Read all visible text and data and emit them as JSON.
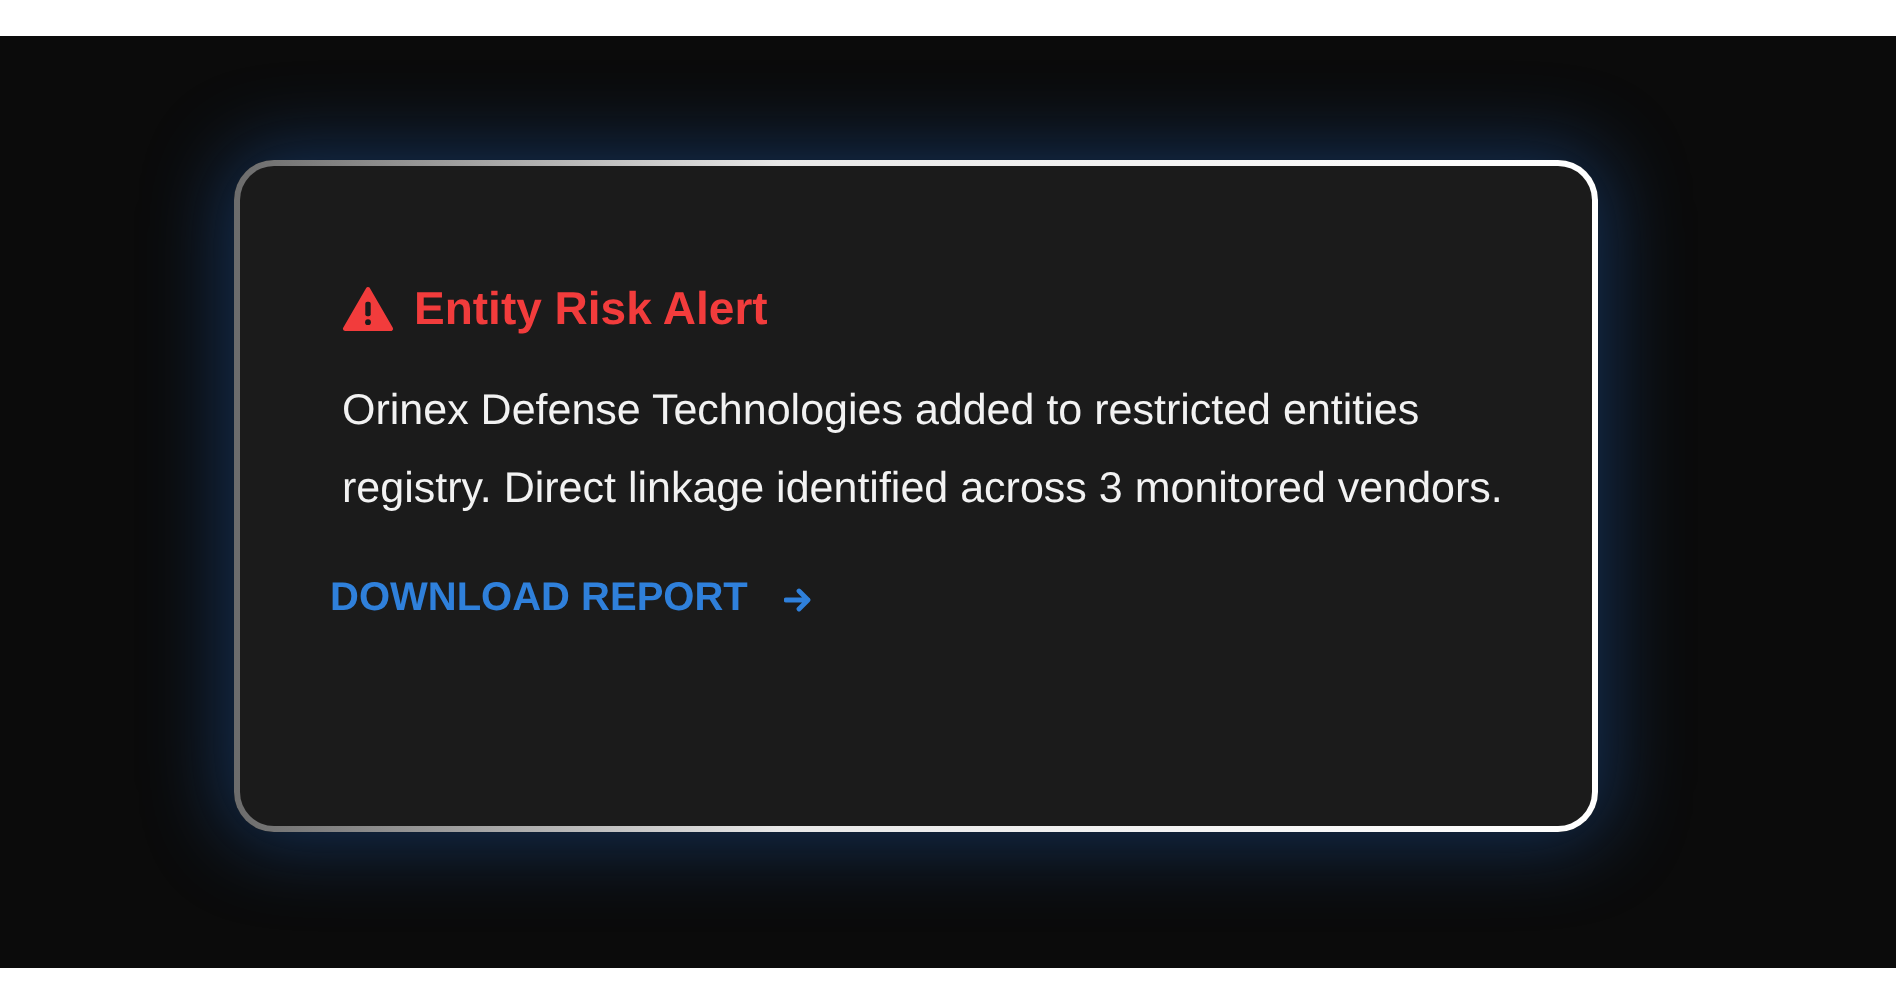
{
  "alert": {
    "title": "Entity Risk Alert",
    "message": "Orinex Defense Technologies added to restricted entities registry. Direct linkage identified across 3 monitored vendors.",
    "action": {
      "label": "DOWNLOAD REPORT"
    }
  }
}
